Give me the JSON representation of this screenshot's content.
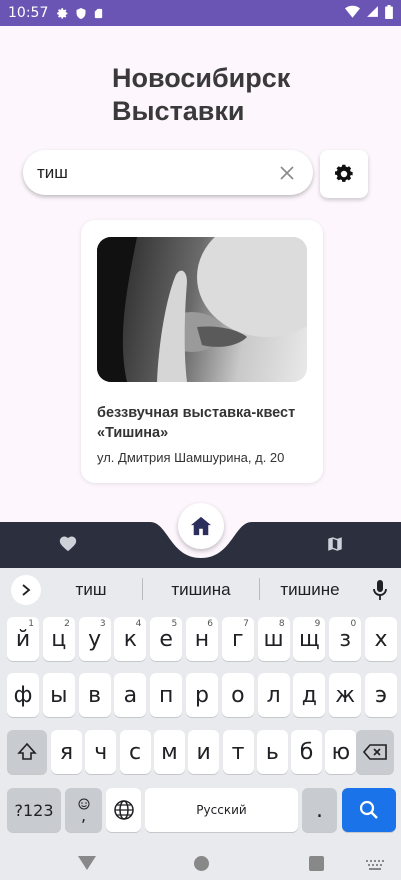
{
  "status_bar": {
    "time": "10:57"
  },
  "header": {
    "title_line1": "Новосибирск",
    "title_line2": "Выставки"
  },
  "search": {
    "value": "тиш"
  },
  "card": {
    "name_line1": "беззвучная выставка-квест",
    "name_line2": "«Тишина»",
    "address": "ул. Дмитрия Шамшурина, д. 20"
  },
  "keyboard": {
    "suggestions": [
      "тиш",
      "тишина",
      "тишине"
    ],
    "row1": [
      [
        "й",
        "1"
      ],
      [
        "ц",
        "2"
      ],
      [
        "у",
        "3"
      ],
      [
        "к",
        "4"
      ],
      [
        "е",
        "5"
      ],
      [
        "н",
        "6"
      ],
      [
        "г",
        "7"
      ],
      [
        "ш",
        "8"
      ],
      [
        "щ",
        "9"
      ],
      [
        "з",
        "0"
      ],
      [
        "х",
        ""
      ]
    ],
    "row2": [
      "ф",
      "ы",
      "в",
      "а",
      "п",
      "р",
      "о",
      "л",
      "д",
      "ж",
      "э"
    ],
    "row3": [
      "я",
      "ч",
      "с",
      "м",
      "и",
      "т",
      "ь",
      "б",
      "ю"
    ],
    "sym_label": "?123",
    "emoji_comma": ",",
    "space_label": "Русский",
    "period": "."
  },
  "colors": {
    "status_bar": "#6a55b4",
    "nav_bar": "#2c2f3e",
    "search_key": "#1a73e8"
  }
}
